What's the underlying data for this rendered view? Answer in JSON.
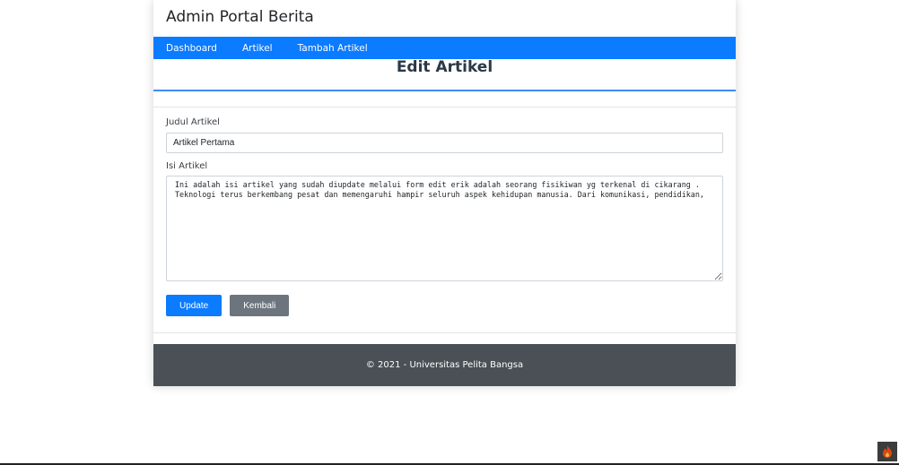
{
  "header": {
    "title": "Admin Portal Berita"
  },
  "nav": {
    "items": [
      "Dashboard",
      "Artikel",
      "Tambah Artikel"
    ]
  },
  "page": {
    "title": "Edit Artikel"
  },
  "form": {
    "judul_label": "Judul Artikel",
    "judul_value": "Artikel Pertama",
    "isi_label": "Isi Artikel",
    "isi_value": "Ini adalah isi artikel yang sudah diupdate melalui form edit erik adalah seorang fisikiwan yg terkenal di cikarang .\nTeknologi terus berkembang pesat dan memengaruhi hampir seluruh aspek kehidupan manusia. Dari komunikasi, pendidikan,",
    "update_label": "Update",
    "kembali_label": "Kembali"
  },
  "footer": {
    "text": "© 2021 - Universitas Pelita Bangsa"
  },
  "debug_toolbar": {
    "icon": "flame-icon",
    "color": "#dd4814"
  },
  "colors": {
    "primary": "#0b7bff",
    "secondary": "#6c757d",
    "footer": "#4a5056"
  }
}
